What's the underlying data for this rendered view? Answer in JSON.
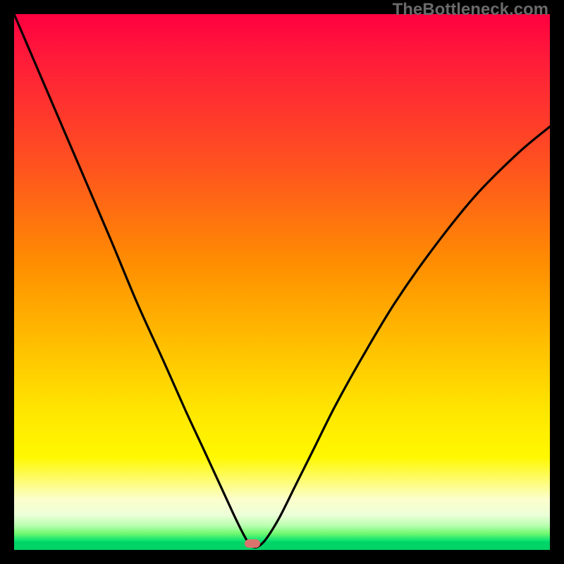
{
  "watermark": "TheBottleneck.com",
  "marker": {
    "x_frac": 0.445,
    "y_frac": 0.988,
    "color": "#d9736e"
  },
  "chart_data": {
    "type": "line",
    "title": "",
    "xlabel": "",
    "ylabel": "",
    "xlim": [
      0,
      1
    ],
    "ylim": [
      0,
      1
    ],
    "series": [
      {
        "name": "curve",
        "x": [
          0.0,
          0.06,
          0.12,
          0.18,
          0.23,
          0.28,
          0.32,
          0.355,
          0.385,
          0.408,
          0.425,
          0.438,
          0.445,
          0.455,
          0.47,
          0.495,
          0.525,
          0.56,
          0.6,
          0.65,
          0.71,
          0.78,
          0.86,
          0.94,
          1.0
        ],
        "y": [
          1.0,
          0.86,
          0.72,
          0.58,
          0.46,
          0.35,
          0.26,
          0.185,
          0.12,
          0.07,
          0.035,
          0.012,
          0.006,
          0.006,
          0.02,
          0.06,
          0.12,
          0.19,
          0.27,
          0.36,
          0.46,
          0.56,
          0.66,
          0.74,
          0.79
        ]
      }
    ],
    "annotations": [
      {
        "text": "TheBottleneck.com",
        "role": "watermark",
        "position": "top-right"
      }
    ]
  }
}
